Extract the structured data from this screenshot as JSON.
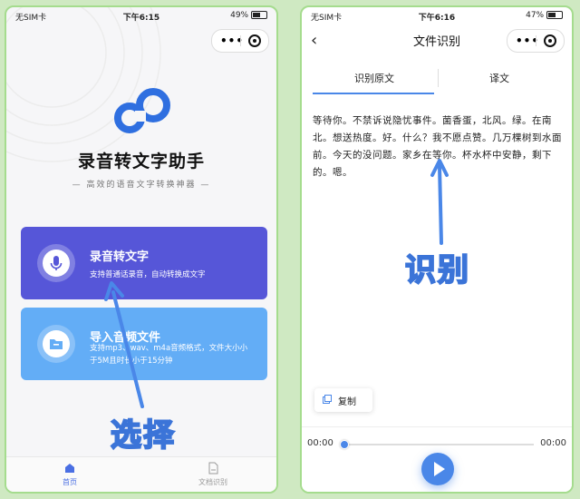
{
  "left": {
    "status": {
      "carrier": "无SIM卡",
      "time": "下午6:15",
      "battery": "49%",
      "battery_level": 0.49
    },
    "app_title": "录音转文字助手",
    "app_subtitle": "— 高效的语音文字转换神器 —",
    "cards": [
      {
        "title": "录音转文字",
        "desc": "支持普通话录音，自动转换成文字"
      },
      {
        "title": "导入音频文件",
        "desc": "支持mp3、wav、m4a音频格式，文件大小小于5M且时长小于15分钟"
      }
    ],
    "tabbar": [
      {
        "label": "首页"
      },
      {
        "label": "文档识别"
      }
    ],
    "annotation": "选择",
    "colors": {
      "record_card": "#5656d8",
      "import_card": "#63adf6",
      "accent": "#4a6fe3"
    }
  },
  "right": {
    "status": {
      "carrier": "无SIM卡",
      "time": "下午6:16",
      "battery": "47%",
      "battery_level": 0.47
    },
    "nav_title": "文件识别",
    "tabs": [
      {
        "label": "识别原文"
      },
      {
        "label": "译文"
      }
    ],
    "content": "等待你。不禁诉说隐忧事件。菌香蛋，北风。绿。在南北。想送热度。好。什么？我不愿点赞。几万棵树到水面前。今天的没问题。家乡在等你。杯水杯中安静，剩下的。嗯。",
    "copy_label": "复制",
    "player": {
      "start": "00:00",
      "end": "00:00"
    },
    "annotation": "识别",
    "colors": {
      "accent": "#4a87e8"
    }
  }
}
